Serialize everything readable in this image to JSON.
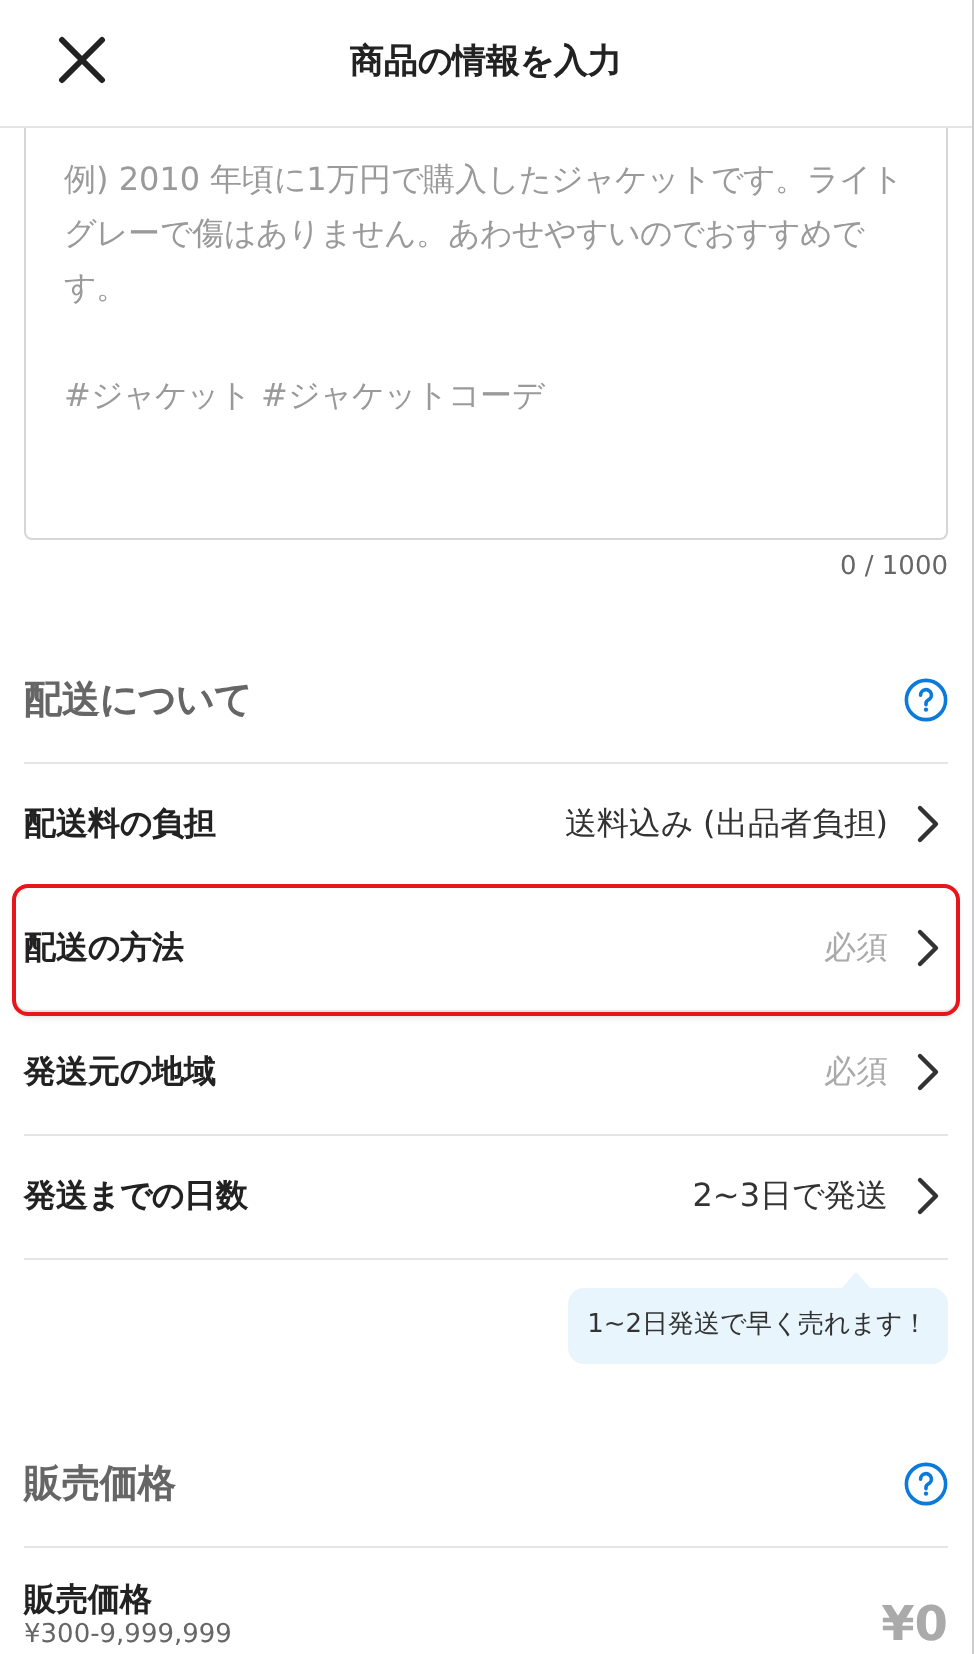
{
  "header": {
    "title": "商品の情報を入力"
  },
  "description": {
    "placeholder": "例) 2010 年頃に1万円で購入したジャケットです。ライトグレーで傷はありません。あわせやすいのでおすすめです。\n\n#ジャケット #ジャケットコーデ",
    "counter": "0 / 1000"
  },
  "shipping": {
    "title": "配送について",
    "rows": [
      {
        "label": "配送料の負担",
        "value": "送料込み (出品者負担)",
        "filled": true,
        "highlighted": false
      },
      {
        "label": "配送の方法",
        "value": "必須",
        "filled": false,
        "highlighted": true
      },
      {
        "label": "発送元の地域",
        "value": "必須",
        "filled": false,
        "highlighted": false
      },
      {
        "label": "発送までの日数",
        "value": "2~3日で発送",
        "filled": true,
        "highlighted": false
      }
    ],
    "tip": "1~2日発送で早く売れます！"
  },
  "price": {
    "title": "販売価格",
    "label": "販売価格",
    "range": "¥300-9,999,999",
    "value": "¥0"
  }
}
